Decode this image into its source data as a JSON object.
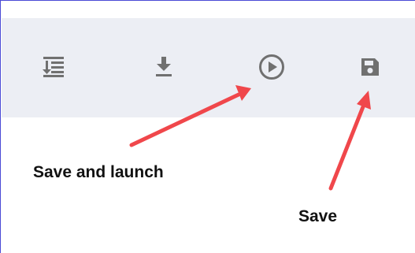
{
  "toolbar": {
    "buttons": [
      {
        "icon": "line-spacing-icon",
        "interactable": true
      },
      {
        "icon": "download-icon",
        "interactable": true
      },
      {
        "icon": "play-circle-icon",
        "interactable": true
      },
      {
        "icon": "floppy-disk-save-icon",
        "interactable": true
      }
    ],
    "background_color": "#eceef4",
    "icon_color": "#707070"
  },
  "annotations": {
    "save_and_launch_label": "Save and launch",
    "save_label": "Save",
    "arrow_color": "#f0474b"
  }
}
